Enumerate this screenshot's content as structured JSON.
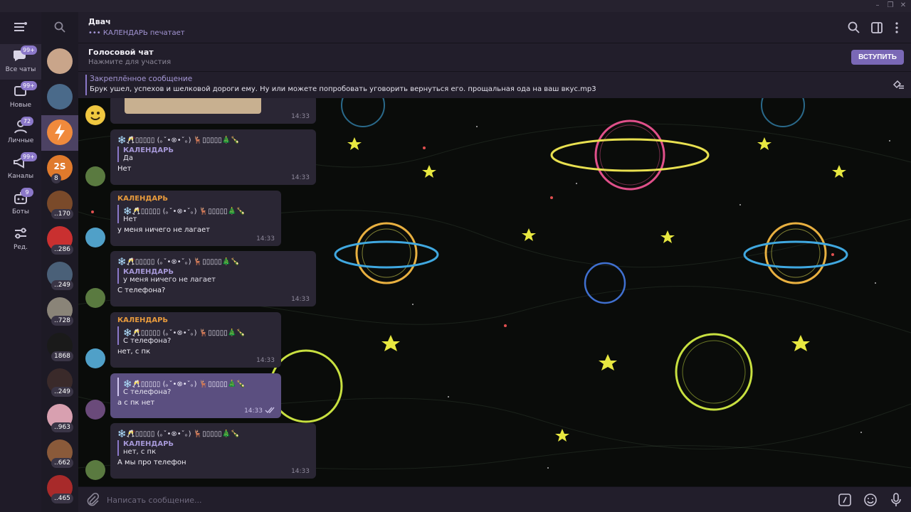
{
  "folders": [
    {
      "label": "Все чаты",
      "badge": "99+",
      "icon": "chats-icon"
    },
    {
      "label": "Новые",
      "badge": "99+",
      "icon": "new-icon"
    },
    {
      "label": "Личные",
      "badge": "72",
      "icon": "person-icon"
    },
    {
      "label": "Каналы",
      "badge": "99+",
      "icon": "channel-icon"
    },
    {
      "label": "Боты",
      "badge": "9",
      "icon": "bot-icon"
    },
    {
      "label": "Ред.",
      "badge": "",
      "icon": "edit-folders-icon"
    }
  ],
  "chats": [
    {
      "badge": "",
      "color": "#c9a58a"
    },
    {
      "badge": "",
      "color": "#4a6a8a"
    },
    {
      "badge": "",
      "color": "#f08a3c"
    },
    {
      "badge": "8",
      "color": "#e07a2c",
      "initials": "2S"
    },
    {
      "badge": "..170",
      "color": "#7a4a2a"
    },
    {
      "badge": "..286",
      "color": "#c93030"
    },
    {
      "badge": "..249",
      "color": "#4a6078"
    },
    {
      "badge": "..728",
      "color": "#8a8478"
    },
    {
      "badge": "1868",
      "color": "#1a1a1a"
    },
    {
      "badge": "..249",
      "color": "#3a2a2a"
    },
    {
      "badge": "..963",
      "color": "#d8a0b0"
    },
    {
      "badge": "..662",
      "color": "#8a5a3a"
    },
    {
      "badge": "..465",
      "color": "#a82a2a"
    }
  ],
  "header": {
    "title": "Двач",
    "status": "••• КАЛЕНДАРЬ печатает"
  },
  "voice": {
    "title": "Голосовой чат",
    "subtitle": "Нажмите для участия",
    "join": "ВСТУПИТЬ"
  },
  "pinned": {
    "title": "Закреплённое сообщение",
    "text": "Брук ушел, успехов и шелковой дороги ему. Ну или можете попробовать уговорить вернуться его. прощальная ода на ваш вкус.mp3"
  },
  "fwd_name": "❄️🥂▯▯▯▯▯ (｡ˇ•⊗•ˇ｡) 🦌▯▯▯▯▯🎄🍾",
  "messages": [
    {
      "time": "14:33"
    },
    {
      "sender": "",
      "fwd": true,
      "reply_name": "КАЛЕНДАРЬ",
      "reply_text": "Да",
      "text": "Нет",
      "time": "14:33"
    },
    {
      "sender": "КАЛЕНДАРЬ",
      "fwd": false,
      "reply_name": "❄️🥂▯▯▯▯▯ (｡ˇ•⊗•ˇ｡) 🦌▯▯▯▯▯🎄🍾",
      "reply_text": "Нет",
      "text": "у меня ничего не лагает",
      "time": "14:33"
    },
    {
      "sender": "",
      "fwd": true,
      "reply_name": "КАЛЕНДАРЬ",
      "reply_text": "у меня ничего не лагает",
      "text": "С телефона?",
      "time": "14:33"
    },
    {
      "sender": "КАЛЕНДАРЬ",
      "fwd": false,
      "reply_name": "❄️🥂▯▯▯▯▯ (｡ˇ•⊗•ˇ｡) 🦌▯▯▯▯▯🎄🍾",
      "reply_text": "С телефона?",
      "text": "нет, с пк",
      "time": "14:33"
    },
    {
      "sender": "",
      "fwd": false,
      "reply_name": "❄️🥂▯▯▯▯▯ (｡ˇ•⊗•ˇ｡) 🦌▯▯▯▯▯🎄🍾",
      "reply_text": "С телефона?",
      "text": "а с пк нет",
      "time": "14:33",
      "out": true
    },
    {
      "sender": "",
      "fwd": true,
      "reply_name": "КАЛЕНДАРЬ",
      "reply_text": "нет, с пк",
      "text": "А мы про телефон",
      "time": "14:33"
    }
  ],
  "composer": {
    "placeholder": "Написать сообщение..."
  },
  "colors": {
    "accent": "#8b78c9",
    "sender": "#e79a3c",
    "background": "#0a0c0a"
  }
}
